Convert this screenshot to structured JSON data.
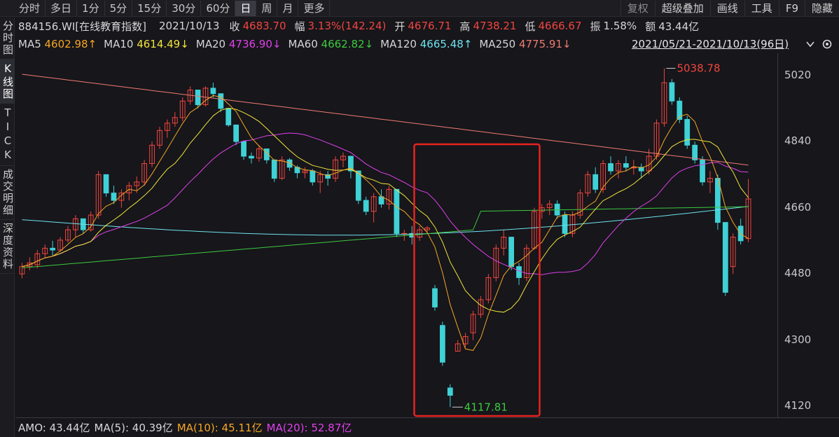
{
  "toolbar": {
    "period_tabs": [
      "分时",
      "多日",
      "1分",
      "5分",
      "15分",
      "30分",
      "60分",
      "日",
      "周",
      "月",
      "更多"
    ],
    "active_tab": "日",
    "right_tools": [
      "复权",
      "超级叠加",
      "画线",
      "工具",
      "F9",
      "隐藏"
    ]
  },
  "left_tabs": [
    {
      "label": "分时图",
      "active": false
    },
    {
      "label": "K线图",
      "active": true
    },
    {
      "label": "TICK",
      "active": false
    },
    {
      "label": "成交明细",
      "active": false
    },
    {
      "label": "深度资料",
      "active": false
    }
  ],
  "info": {
    "code_name": "884156.WI[在线教育指数]",
    "date": "2021/10/13",
    "close_label": "收",
    "close_value": "4683.70",
    "change_label": "幅",
    "change_value": "3.13%(142.24)",
    "open_label": "开",
    "open_value": "4676.71",
    "high_label": "高",
    "high_value": "4738.21",
    "low_label": "低",
    "low_value": "4666.67",
    "amplitude_label": "振",
    "amplitude_value": "1.58%",
    "amount_label": "额",
    "amount_value": "43.44亿"
  },
  "ma": [
    {
      "name": "MA5",
      "value": "4602.98",
      "arrow": "↑",
      "color": "#f5a623"
    },
    {
      "name": "MA10",
      "value": "4614.49",
      "arrow": "↓",
      "color": "#f2e43a"
    },
    {
      "name": "MA20",
      "value": "4736.90",
      "arrow": "↓",
      "color": "#e040e8"
    },
    {
      "name": "MA60",
      "value": "4662.82",
      "arrow": "↓",
      "color": "#3ec93e"
    },
    {
      "name": "MA120",
      "value": "4665.48",
      "arrow": "↑",
      "color": "#6fe2ec"
    },
    {
      "name": "MA250",
      "value": "4775.91",
      "arrow": "↓",
      "color": "#f07a70"
    }
  ],
  "range_text": "2021/05/21-2021/10/13(96日)",
  "y_ticks": [
    "5020",
    "4840",
    "4660",
    "4480",
    "4300",
    "4120"
  ],
  "annotations": {
    "max_label": "5038.78",
    "min_label": "4117.81"
  },
  "amo": {
    "amo_label": "AMO: 43.44亿",
    "ma5_label": "MA(5): 40.39亿",
    "ma10_label": "MA(10): 45.11亿",
    "ma20_label": "MA(20): 52.87亿",
    "ma10_color": "#f5a623",
    "ma20_color": "#e040e8"
  },
  "colors": {
    "up": "#f0453e",
    "down": "#3fd1d6",
    "highlight_box": "#e8231f"
  },
  "chart_data": {
    "type": "candlestick",
    "y_range": [
      4090,
      5080
    ],
    "candles": [
      [
        4480,
        4510,
        4468,
        4500
      ],
      [
        4500,
        4525,
        4490,
        4510
      ],
      [
        4505,
        4545,
        4495,
        4535
      ],
      [
        4535,
        4560,
        4525,
        4550
      ],
      [
        4550,
        4570,
        4530,
        4545
      ],
      [
        4545,
        4580,
        4540,
        4572
      ],
      [
        4572,
        4610,
        4565,
        4600
      ],
      [
        4600,
        4640,
        4580,
        4630
      ],
      [
        4630,
        4625,
        4590,
        4600
      ],
      [
        4600,
        4650,
        4595,
        4640
      ],
      [
        4640,
        4760,
        4630,
        4750
      ],
      [
        4750,
        4740,
        4690,
        4700
      ],
      [
        4700,
        4720,
        4670,
        4680
      ],
      [
        4680,
        4710,
        4660,
        4700
      ],
      [
        4700,
        4730,
        4680,
        4720
      ],
      [
        4720,
        4745,
        4700,
        4730
      ],
      [
        4730,
        4790,
        4720,
        4780
      ],
      [
        4780,
        4840,
        4770,
        4830
      ],
      [
        4830,
        4880,
        4820,
        4870
      ],
      [
        4870,
        4900,
        4850,
        4890
      ],
      [
        4890,
        4920,
        4880,
        4905
      ],
      [
        4905,
        4960,
        4895,
        4950
      ],
      [
        4950,
        4990,
        4940,
        4980
      ],
      [
        4980,
        4975,
        4930,
        4940
      ],
      [
        4940,
        4990,
        4935,
        4985
      ],
      [
        4985,
        5000,
        4960,
        4970
      ],
      [
        4970,
        4960,
        4920,
        4930
      ],
      [
        4930,
        4920,
        4880,
        4885
      ],
      [
        4885,
        4880,
        4830,
        4840
      ],
      [
        4840,
        4830,
        4790,
        4800
      ],
      [
        4800,
        4810,
        4780,
        4795
      ],
      [
        4795,
        4830,
        4785,
        4820
      ],
      [
        4820,
        4810,
        4780,
        4790
      ],
      [
        4790,
        4780,
        4730,
        4740
      ],
      [
        4740,
        4800,
        4735,
        4790
      ],
      [
        4790,
        4795,
        4760,
        4770
      ],
      [
        4770,
        4775,
        4740,
        4755
      ],
      [
        4755,
        4770,
        4740,
        4760
      ],
      [
        4760,
        4765,
        4720,
        4730
      ],
      [
        4730,
        4760,
        4700,
        4750
      ],
      [
        4750,
        4760,
        4720,
        4740
      ],
      [
        4740,
        4800,
        4730,
        4790
      ],
      [
        4790,
        4810,
        4770,
        4800
      ],
      [
        4800,
        4790,
        4740,
        4760
      ],
      [
        4760,
        4750,
        4670,
        4680
      ],
      [
        4680,
        4690,
        4640,
        4650
      ],
      [
        4650,
        4700,
        4620,
        4690
      ],
      [
        4690,
        4710,
        4660,
        4670
      ],
      [
        4670,
        4720,
        4655,
        4710
      ],
      [
        4710,
        4640,
        4580,
        4590
      ],
      [
        4590,
        4600,
        4570,
        4590
      ],
      [
        4590,
        4610,
        4560,
        4580
      ],
      [
        4580,
        4610,
        4570,
        4600
      ],
      [
        4600,
        4610,
        4590,
        4605
      ],
      [
        4440,
        4450,
        4380,
        4390
      ],
      [
        4340,
        4350,
        4230,
        4240
      ],
      [
        4170,
        4180,
        4118,
        4150
      ],
      [
        4270,
        4300,
        4270,
        4290
      ],
      [
        4290,
        4320,
        4280,
        4310
      ],
      [
        4320,
        4380,
        4300,
        4370
      ],
      [
        4370,
        4420,
        4360,
        4410
      ],
      [
        4410,
        4480,
        4400,
        4470
      ],
      [
        4470,
        4560,
        4460,
        4550
      ],
      [
        4550,
        4600,
        4530,
        4580
      ],
      [
        4580,
        4570,
        4490,
        4500
      ],
      [
        4500,
        4510,
        4450,
        4470
      ],
      [
        4470,
        4560,
        4460,
        4550
      ],
      [
        4550,
        4660,
        4545,
        4650
      ],
      [
        4650,
        4670,
        4630,
        4660
      ],
      [
        4660,
        4680,
        4640,
        4670
      ],
      [
        4670,
        4680,
        4630,
        4640
      ],
      [
        4640,
        4650,
        4580,
        4590
      ],
      [
        4590,
        4650,
        4580,
        4640
      ],
      [
        4640,
        4710,
        4630,
        4700
      ],
      [
        4700,
        4760,
        4690,
        4750
      ],
      [
        4750,
        4770,
        4700,
        4710
      ],
      [
        4710,
        4790,
        4700,
        4780
      ],
      [
        4780,
        4800,
        4750,
        4760
      ],
      [
        4760,
        4790,
        4740,
        4780
      ],
      [
        4780,
        4800,
        4760,
        4770
      ],
      [
        4770,
        4790,
        4750,
        4770
      ],
      [
        4770,
        4780,
        4740,
        4760
      ],
      [
        4760,
        4820,
        4750,
        4800
      ],
      [
        4800,
        4900,
        4790,
        4890
      ],
      [
        4890,
        5039,
        4880,
        5000
      ],
      [
        5000,
        5010,
        4940,
        4950
      ],
      [
        4950,
        4960,
        4890,
        4900
      ],
      [
        4900,
        4910,
        4820,
        4830
      ],
      [
        4830,
        4840,
        4780,
        4790
      ],
      [
        4790,
        4800,
        4720,
        4730
      ],
      [
        4730,
        4760,
        4700,
        4740
      ],
      [
        4740,
        4750,
        4600,
        4620
      ],
      [
        4620,
        4610,
        4420,
        4430
      ],
      [
        4500,
        4590,
        4480,
        4580
      ],
      [
        4610,
        4630,
        4560,
        4570
      ],
      [
        4576,
        4738,
        4566,
        4684
      ]
    ]
  }
}
